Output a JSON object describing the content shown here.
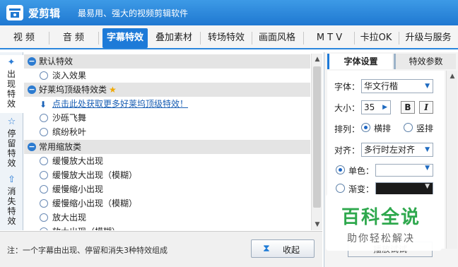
{
  "app": {
    "name": "爱剪辑",
    "slogan": "最易用、强大的视频剪辑软件"
  },
  "tabs": [
    {
      "label": "视  频"
    },
    {
      "label": "音  频"
    },
    {
      "label": "字幕特效",
      "active": true
    },
    {
      "label": "叠加素材"
    },
    {
      "label": "转场特效"
    },
    {
      "label": "画面风格"
    },
    {
      "label": "M T V"
    },
    {
      "label": "卡拉OK"
    },
    {
      "label": "升级与服务"
    }
  ],
  "side_tabs": [
    {
      "label": "出现特效",
      "icon": "arrow-in-icon",
      "active": true
    },
    {
      "label": "停留特效",
      "icon": "pin-icon"
    },
    {
      "label": "消失特效",
      "icon": "arrow-out-icon"
    }
  ],
  "effects": {
    "groups": [
      {
        "label": "默认特效",
        "items": [
          "淡入效果"
        ]
      },
      {
        "label": "好莱坞顶级特效类",
        "link": "点击此处获取更多好莱坞顶级特效！",
        "items": [
          "沙砾飞舞",
          "缤纷秋叶"
        ]
      },
      {
        "label": "常用缩放类",
        "items": [
          "缓慢放大出现",
          "缓慢放大出现（模糊）",
          "缓慢缩小出现",
          "缓慢缩小出现（模糊）",
          "放大出现",
          "放大出现（模糊）"
        ]
      }
    ]
  },
  "bottom": {
    "note": "注：一个字幕由出现、停留和消失3种特效组成",
    "collapse_label": "收起"
  },
  "right_panel": {
    "tabs": [
      "字体设置",
      "特效参数"
    ],
    "font_label": "字体：",
    "font_value": "华文行楷",
    "size_label": "大小：",
    "size_value": "35",
    "bold_label": "B",
    "italic_label": "I",
    "arrange_label": "排列：",
    "arrange_horizontal": "横排",
    "arrange_vertical": "竖排",
    "align_label": "对齐：",
    "align_value": "多行时左对齐",
    "single_color_label": "单色：",
    "gradient_label": "渐变：",
    "preview_label": "播放试试"
  },
  "watermark": {
    "title": "百科全说",
    "subtitle": "助你轻松解决"
  },
  "colors": {
    "accent": "#1d7ad8",
    "title_bar": "#2a86dc",
    "group_row": "#e4e4e4",
    "star": "#f0a800",
    "watermark_green": "#2ea84d"
  }
}
